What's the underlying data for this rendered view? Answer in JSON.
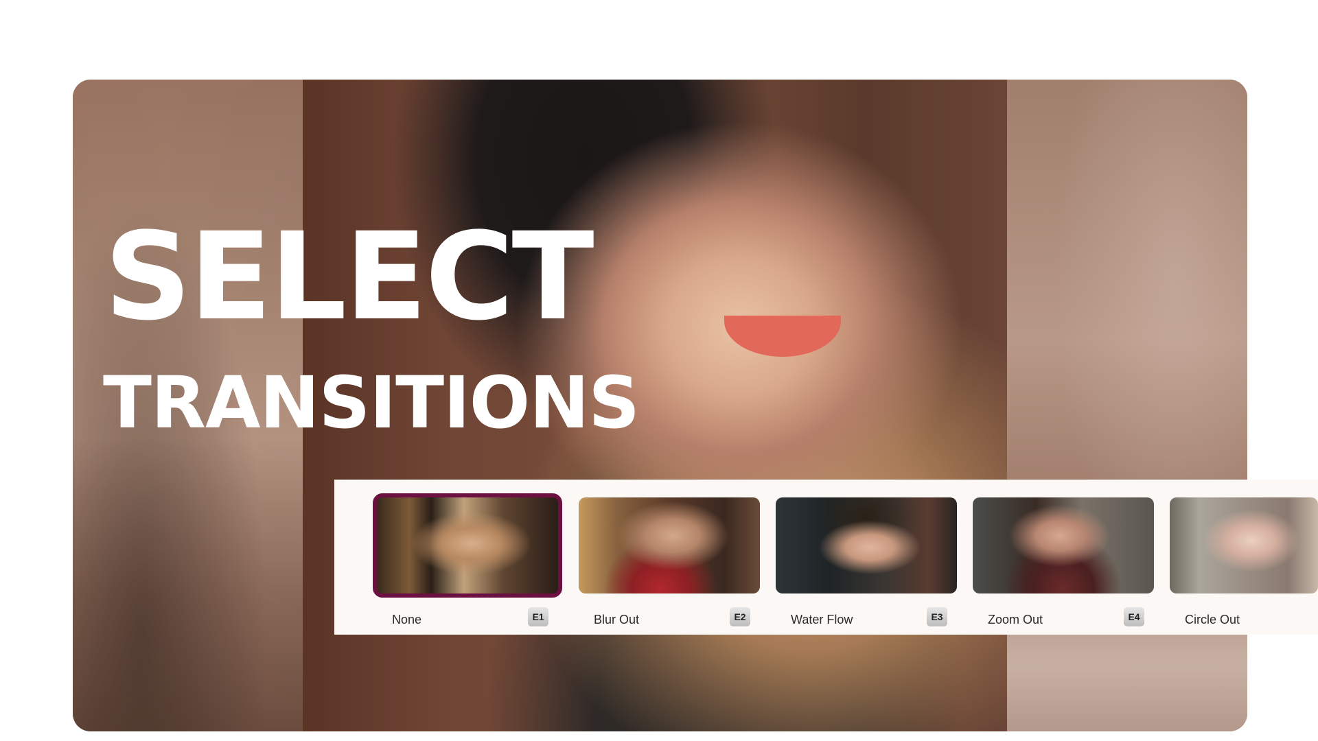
{
  "hero": {
    "title_line1": "SELECT",
    "title_line2": "TRANSITIONS"
  },
  "transitions": [
    {
      "label": "None",
      "badge": "E1",
      "selected": true
    },
    {
      "label": "Blur Out",
      "badge": "E2",
      "selected": false
    },
    {
      "label": "Water Flow",
      "badge": "E3",
      "selected": false
    },
    {
      "label": "Zoom Out",
      "badge": "E4",
      "selected": false
    },
    {
      "label": "Circle Out",
      "badge": "",
      "selected": false
    }
  ],
  "colors": {
    "selected_border": "#6b1040",
    "strip_background": "#fbf8f5",
    "title": "#ffffff"
  }
}
